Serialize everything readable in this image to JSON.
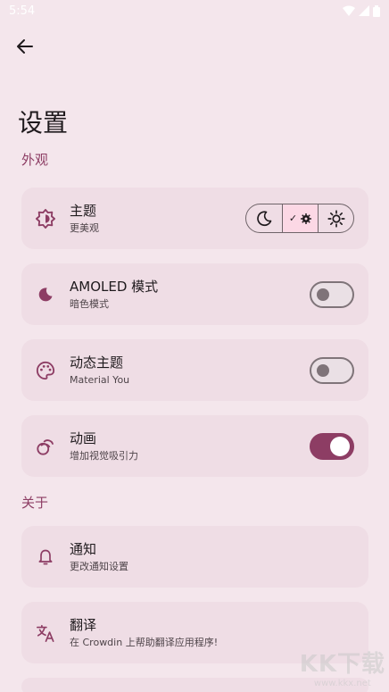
{
  "status_bar": {
    "time": "5:54"
  },
  "page": {
    "title": "设置"
  },
  "sections": {
    "appearance": "外观",
    "about": "关于"
  },
  "items": {
    "theme": {
      "title": "主题",
      "subtitle": "更美观"
    },
    "amoled": {
      "title": "AMOLED 模式",
      "subtitle": "暗色模式",
      "enabled": false
    },
    "dynamic_theme": {
      "title": "动态主题",
      "subtitle": "Material You",
      "enabled": false
    },
    "animation": {
      "title": "动画",
      "subtitle": "增加视觉吸引力",
      "enabled": true
    },
    "notifications": {
      "title": "通知",
      "subtitle": "更改通知设置"
    },
    "translate": {
      "title": "翻译",
      "subtitle": "在 Crowdin 上帮助翻译应用程序!"
    }
  },
  "theme_selector": {
    "options": [
      "dark",
      "auto",
      "light"
    ],
    "selected": "auto",
    "check_mark": "✓"
  },
  "watermark": {
    "logo": "KK下载",
    "url": "www.kkx.net"
  },
  "colors": {
    "background": "#f4e6ec",
    "card": "#efdde5",
    "accent": "#8d3d64"
  }
}
